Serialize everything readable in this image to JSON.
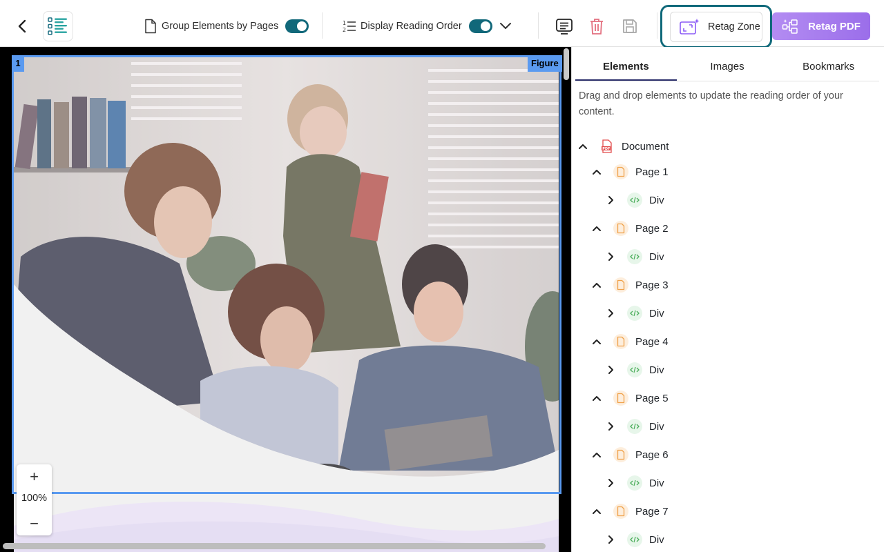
{
  "toolbar": {
    "group_label": "Group Elements by Pages",
    "reading_label": "Display Reading Order",
    "retag_zone_label": "Retag Zone",
    "retag_pdf_label": "Retag PDF",
    "accent": "#11687a",
    "highlight": "#10697a"
  },
  "viewer": {
    "selection_index": "1",
    "selection_type": "Figure",
    "zoom_level": "100%",
    "zoom_in": "+",
    "zoom_out": "−"
  },
  "panel": {
    "tabs": [
      "Elements",
      "Images",
      "Bookmarks"
    ],
    "active_tab": "Elements",
    "hint": "Drag and drop elements to update the reading order of your content.",
    "tree": {
      "root": "Document",
      "pages": [
        {
          "label": "Page 1",
          "child": "Div"
        },
        {
          "label": "Page 2",
          "child": "Div"
        },
        {
          "label": "Page 3",
          "child": "Div"
        },
        {
          "label": "Page 4",
          "child": "Div"
        },
        {
          "label": "Page 5",
          "child": "Div"
        },
        {
          "label": "Page 6",
          "child": "Div"
        },
        {
          "label": "Page 7",
          "child": "Div"
        }
      ]
    }
  }
}
